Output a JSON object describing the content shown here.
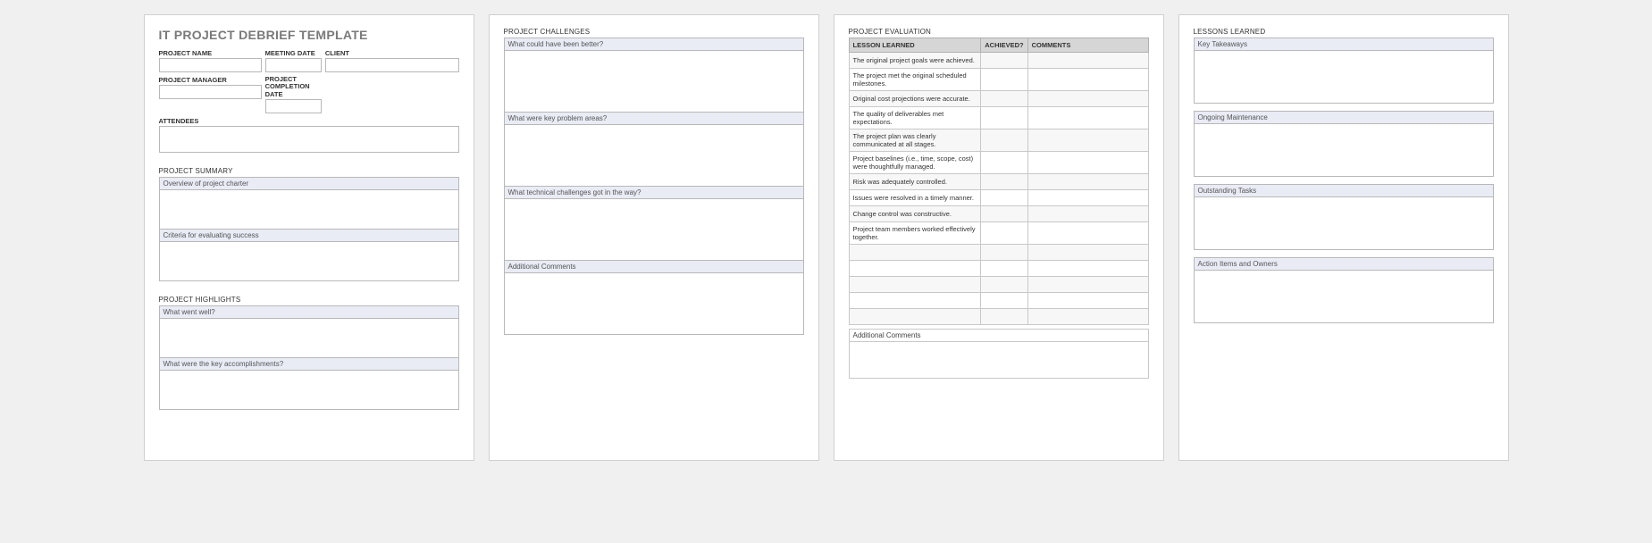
{
  "page1": {
    "title": "IT PROJECT DEBRIEF TEMPLATE",
    "fields": {
      "project_name": "PROJECT NAME",
      "meeting_date": "MEETING DATE",
      "client": "CLIENT",
      "project_manager": "PROJECT MANAGER",
      "project_completion_date": "PROJECT COMPLETION DATE",
      "attendees": "ATTENDEES"
    },
    "summary": {
      "heading": "PROJECT SUMMARY",
      "overview": "Overview of project charter",
      "criteria": "Criteria for evaluating success"
    },
    "highlights": {
      "heading": "PROJECT HIGHLIGHTS",
      "went_well": "What went well?",
      "accomplishments": "What were the key accomplishments?"
    }
  },
  "page2": {
    "heading": "PROJECT CHALLENGES",
    "q1": "What could have been better?",
    "q2": "What were key problem areas?",
    "q3": "What technical challenges got in the way?",
    "q4": "Additional Comments"
  },
  "page3": {
    "heading": "PROJECT EVALUATION",
    "cols": {
      "lesson": "LESSON LEARNED",
      "achieved": "ACHIEVED?",
      "comments": "COMMENTS"
    },
    "rows": [
      "The original project goals were achieved.",
      "The project met the original scheduled milestones.",
      "Original cost projections were accurate.",
      "The quality of deliverables met expectations.",
      "The project plan was clearly communicated at all stages.",
      "Project baselines (i.e., time, scope, cost) were thoughtfully managed.",
      "Risk was adequately controlled.",
      "Issues were resolved in a timely manner.",
      "Change control was constructive.",
      "Project team members worked effectively together."
    ],
    "additional": "Additional Comments"
  },
  "page4": {
    "heading": "LESSONS LEARNED",
    "s1": "Key Takeaways",
    "s2": "Ongoing Maintenance",
    "s3": "Outstanding Tasks",
    "s4": "Action Items and Owners"
  }
}
